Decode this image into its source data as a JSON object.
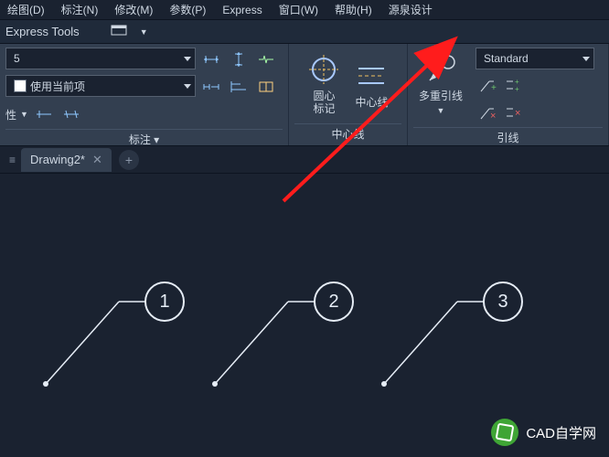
{
  "menu": {
    "items": [
      "绘图(D)",
      "标注(N)",
      "修改(M)",
      "参数(P)",
      "Express",
      "窗口(W)",
      "帮助(H)",
      "源泉设计"
    ]
  },
  "subbar": {
    "title": "Express Tools"
  },
  "ribbon": {
    "dimPanel": {
      "style": "5",
      "layer": "使用当前项",
      "prop": "性",
      "label": "标注"
    },
    "dimIcons": {
      "i1": "linear-dim-icon",
      "i2": "aligned-dim-icon",
      "i3": "breakline-icon",
      "i4": "continue-dim-icon",
      "i5": "baseline-dim-icon",
      "i6": "tolerance-icon",
      "i7": "quick-dim-icon",
      "i8": "oblique-dim-icon"
    },
    "centerPanel": {
      "btn1": "圆心\n标记",
      "btn2": "中心线",
      "label": "中心线"
    },
    "leaderPanel": {
      "btn": "多重引线",
      "style": "Standard",
      "label": "引线"
    },
    "leaderIcons": {
      "add": "add-leader-icon",
      "remove": "remove-leader-icon",
      "align": "align-leader-icon",
      "collect": "collect-leader-icon"
    }
  },
  "tabs": {
    "active": "Drawing2*"
  },
  "leaders": {
    "n1": "1",
    "n2": "2",
    "n3": "3"
  },
  "watermark": {
    "text": "CAD自学网"
  }
}
